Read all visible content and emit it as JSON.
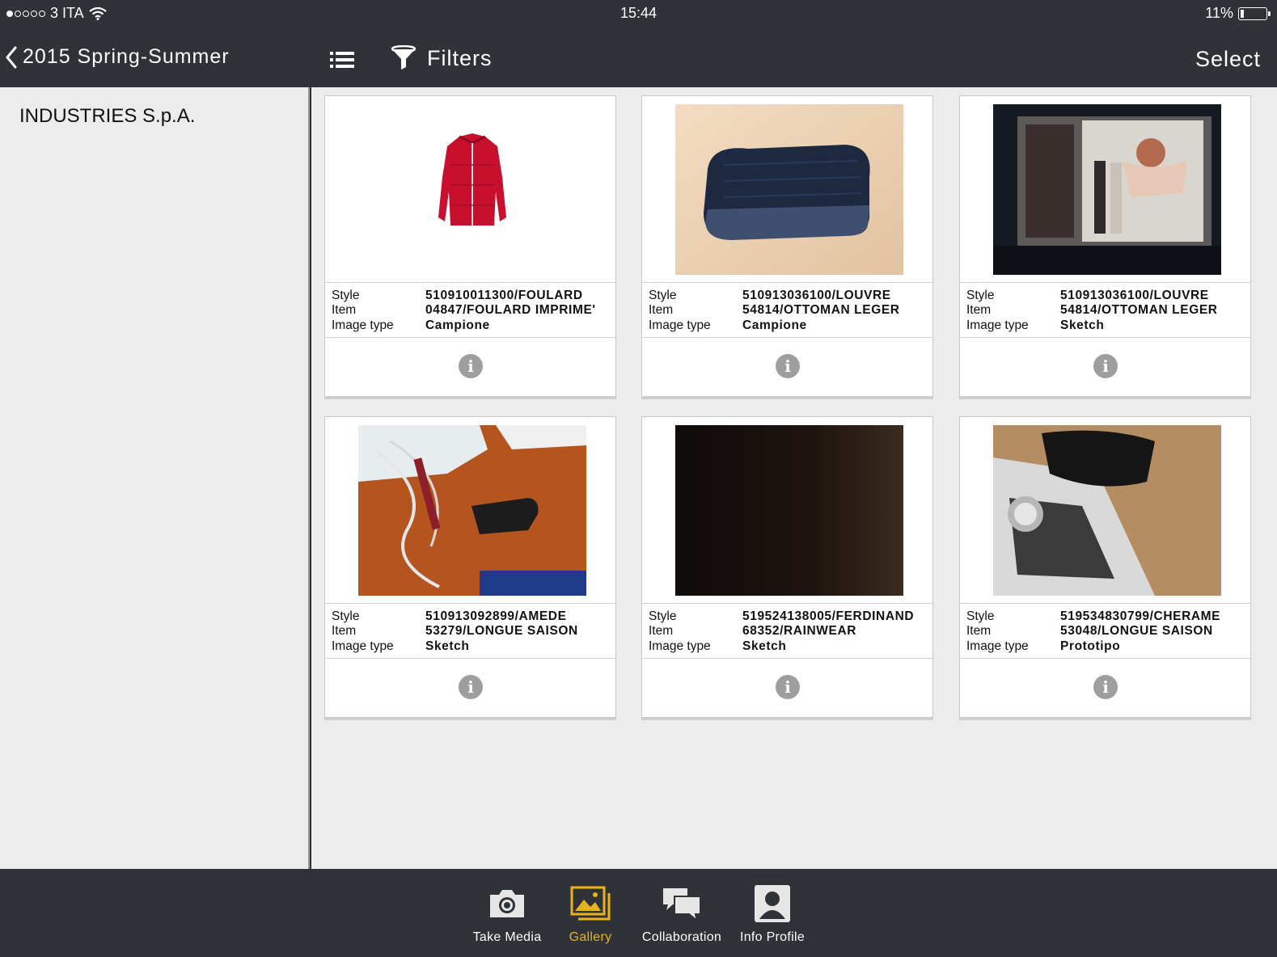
{
  "status_bar": {
    "carrier": "3 ITA",
    "time": "15:44",
    "battery": "11%"
  },
  "nav": {
    "back_label": "2015 Spring-Summer",
    "filters_label": "Filters",
    "select_label": "Select"
  },
  "sidebar": {
    "company": "INDUSTRIES S.p.A."
  },
  "labels": {
    "style": "Style",
    "item": "Item",
    "image_type": "Image type"
  },
  "cards": [
    {
      "thumb": "red-jacket-photo",
      "style": "510910011300/FOULARD",
      "item": "04847/FOULARD IMPRIME'",
      "image_type": "Campione"
    },
    {
      "thumb": "navy-pouch-photo",
      "style": "510913036100/LOUVRE",
      "item": "54814/OTTOMAN LEGER",
      "image_type": "Campione"
    },
    {
      "thumb": "store-window-photo",
      "style": "510913036100/LOUVRE",
      "item": "54814/OTTOMAN LEGER",
      "image_type": "Sketch"
    },
    {
      "thumb": "desk-keys-photo",
      "style": "510913092899/AMEDE",
      "item": "53279/LONGUE SAISON",
      "image_type": "Sketch"
    },
    {
      "thumb": "dark-photo",
      "style": "519524138005/FERDINAND",
      "item": "68352/RAINWEAR",
      "image_type": "Sketch"
    },
    {
      "thumb": "wallet-watch-photo",
      "style": "519534830799/CHERAME",
      "item": "53048/LONGUE SAISON",
      "image_type": "Prototipo"
    }
  ],
  "tabs": [
    {
      "label": "Take Media",
      "icon": "camera-icon"
    },
    {
      "label": "Gallery",
      "icon": "gallery-icon",
      "active": true
    },
    {
      "label": "Collaboration",
      "icon": "chat-bubbles-icon"
    },
    {
      "label": "Info Profile",
      "icon": "profile-icon"
    }
  ],
  "colors": {
    "chrome": "#2f3337",
    "background": "#ececec",
    "active_tab": "#e8b31a"
  }
}
